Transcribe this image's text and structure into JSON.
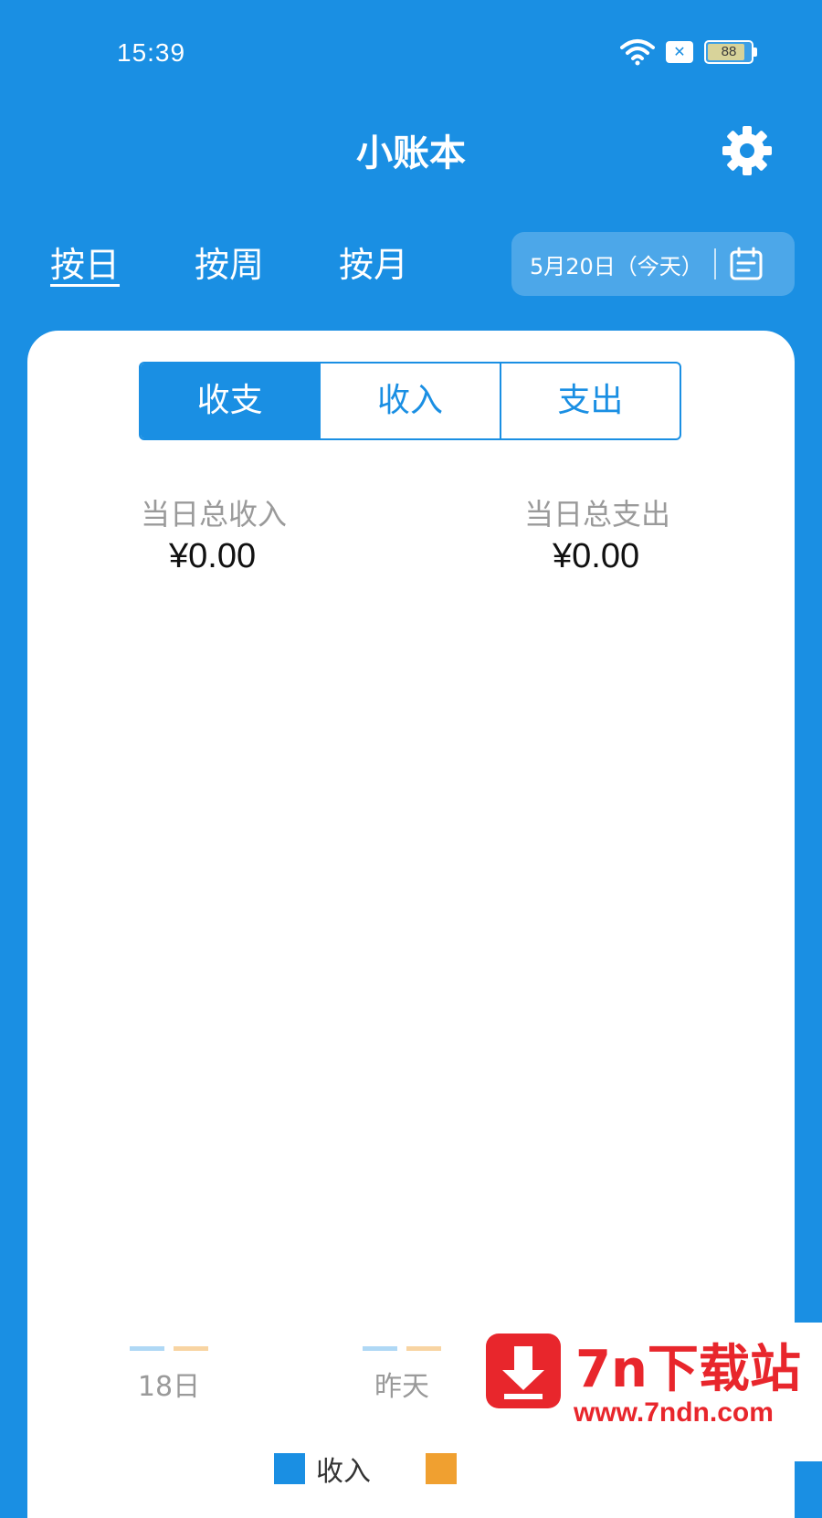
{
  "status_bar": {
    "time": "15:39",
    "battery_level": "88",
    "battery_fraction": 0.88,
    "icons": [
      "wifi-icon",
      "sim-error-icon",
      "battery-icon"
    ]
  },
  "header": {
    "title": "小账本",
    "settings_icon": "gear-icon"
  },
  "period_tabs": [
    {
      "label": "按日",
      "active": true
    },
    {
      "label": "按周",
      "active": false
    },
    {
      "label": "按月",
      "active": false
    }
  ],
  "date_picker": {
    "label": "5月20日（今天）",
    "icon": "calendar-icon"
  },
  "segmented": [
    {
      "label": "收支",
      "active": true
    },
    {
      "label": "收入",
      "active": false
    },
    {
      "label": "支出",
      "active": false
    }
  ],
  "summary": {
    "income_label": "当日总收入",
    "income_value": "¥0.00",
    "expense_label": "当日总支出",
    "expense_value": "¥0.00"
  },
  "chart": {
    "x_ticks": [
      "18日",
      "昨天"
    ],
    "legend": [
      "收入"
    ]
  },
  "colors": {
    "primary": "#1a8fe3",
    "income_series": "#1a8fe3",
    "expense_series": "#f0a030"
  },
  "watermark": {
    "title": "7n下载站",
    "url": "www.7ndn.com"
  }
}
